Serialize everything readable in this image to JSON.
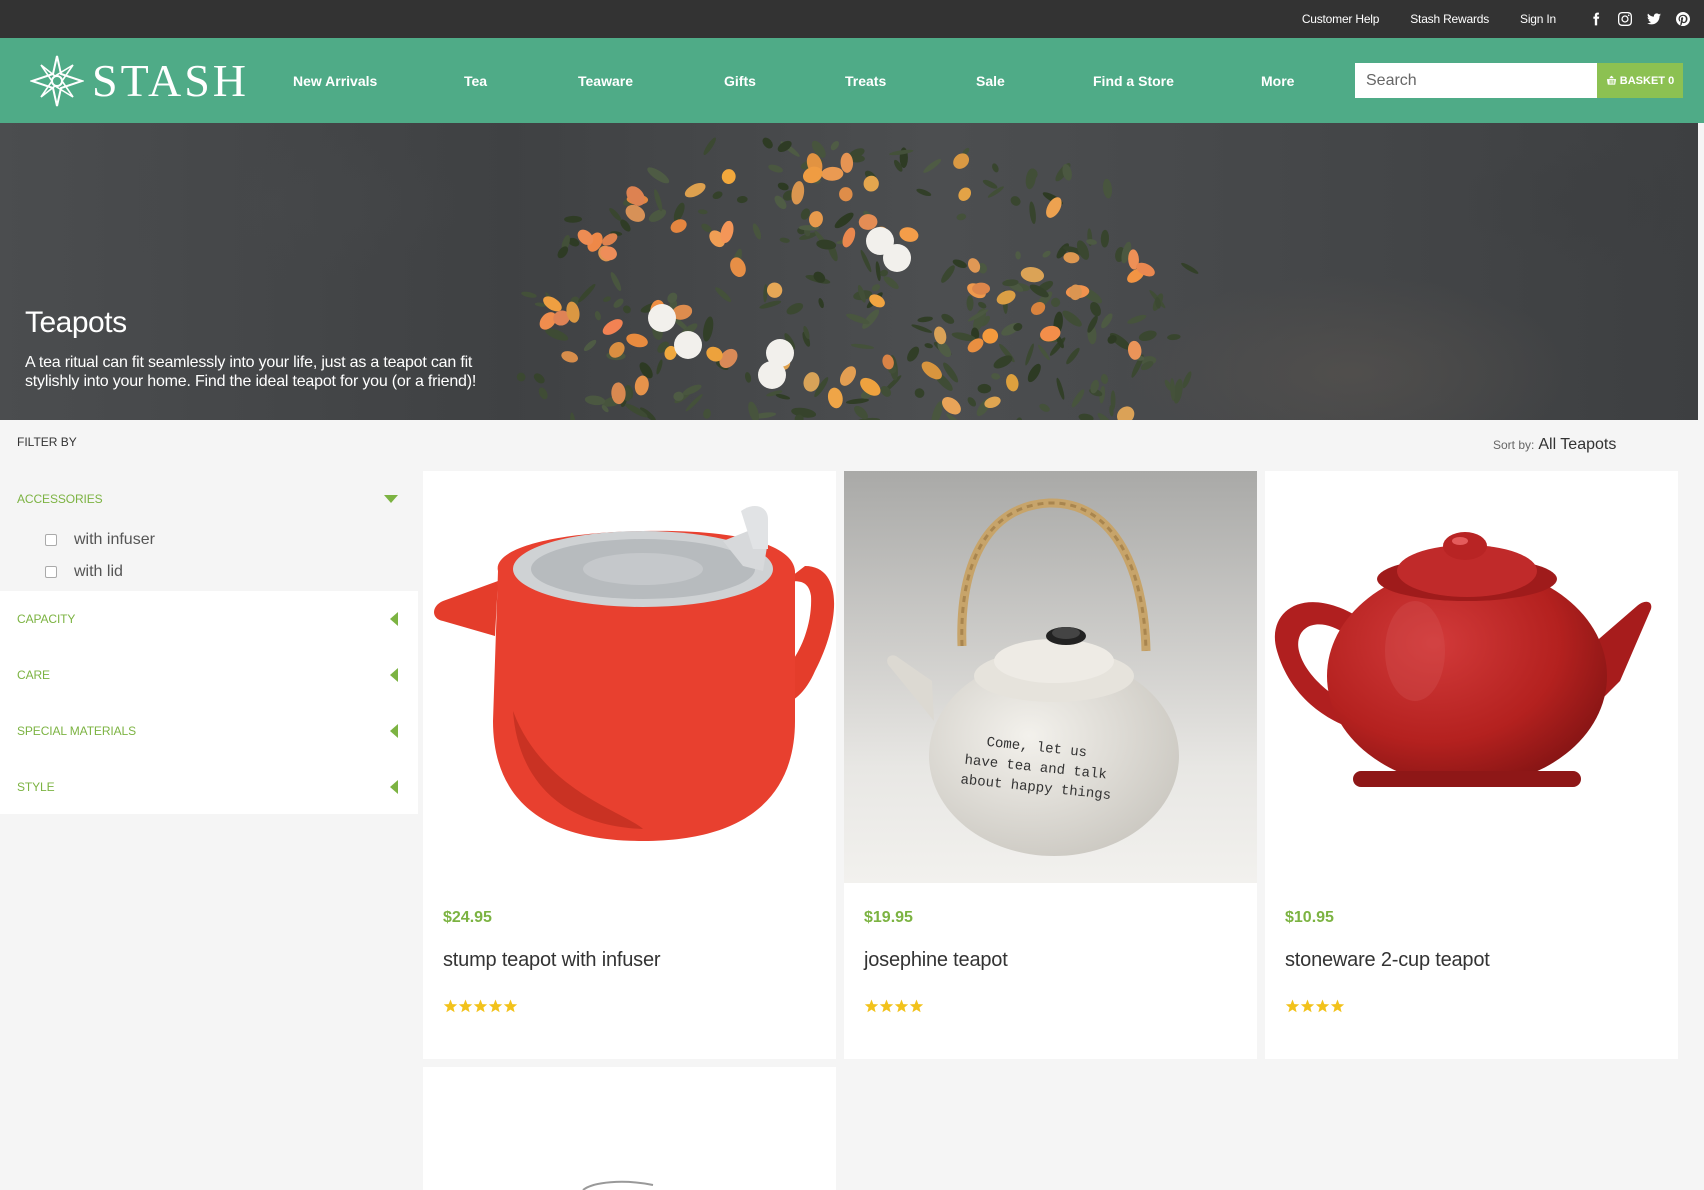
{
  "topbar": {
    "links": [
      "Customer Help",
      "Stash Rewards",
      "Sign In"
    ],
    "social": [
      "facebook-icon",
      "instagram-icon",
      "twitter-icon",
      "pinterest-icon"
    ]
  },
  "header": {
    "brand": "STASH",
    "nav": [
      "New Arrivals",
      "Tea",
      "Teaware",
      "Gifts",
      "Treats",
      "Sale",
      "Find a Store",
      "More"
    ],
    "search_placeholder": "Search",
    "basket_label": "BASKET 0"
  },
  "hero": {
    "title": "Teapots",
    "description": "A tea ritual can fit seamlessly into your life, just as a teapot can fit stylishly into your home. Find the ideal teapot for you (or a friend)!"
  },
  "toolbar": {
    "filter_label": "FILTER BY",
    "sort_label": "Sort by:",
    "sort_value": "All Teapots"
  },
  "filters": {
    "facets": [
      {
        "label": "ACCESSORIES",
        "state": "open"
      },
      {
        "label": "CAPACITY",
        "state": "closed"
      },
      {
        "label": "CARE",
        "state": "closed"
      },
      {
        "label": "SPECIAL MATERIALS",
        "state": "closed"
      },
      {
        "label": "STYLE",
        "state": "closed"
      }
    ],
    "accessories_options": [
      "with infuser",
      "with lid"
    ]
  },
  "products": [
    {
      "price": "$24.95",
      "name": "stump teapot with infuser",
      "rating": 5
    },
    {
      "price": "$19.95",
      "name": "josephine teapot",
      "rating": 4,
      "image_text": [
        "Come, let us",
        "have tea and talk",
        "about happy things"
      ]
    },
    {
      "price": "$10.95",
      "name": "stoneware 2-cup teapot",
      "rating": 4
    }
  ],
  "colors": {
    "topbar": "#333333",
    "nav": "#4fab87",
    "accent_green": "#7cb342",
    "basket": "#8cc152",
    "star": "#f2c21b"
  }
}
